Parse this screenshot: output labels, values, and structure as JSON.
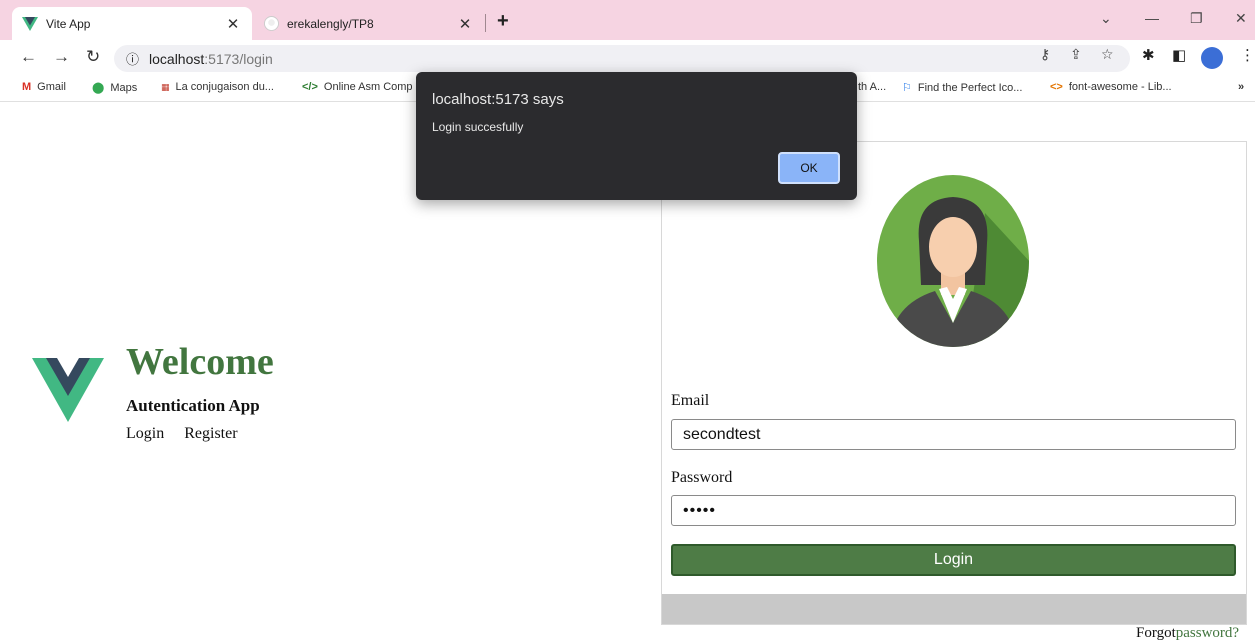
{
  "browser": {
    "tabs": [
      {
        "title": "Vite App",
        "active": true
      },
      {
        "title": "erekalengly/TP8",
        "active": false
      }
    ],
    "url_host": "localhost",
    "url_path": ":5173/login",
    "bookmarks": [
      {
        "label": "Gmail"
      },
      {
        "label": "Maps"
      },
      {
        "label": "La conjugaison du..."
      },
      {
        "label": "Online Asm Comp"
      },
      {
        "label": "th A..."
      },
      {
        "label": "Find the Perfect Ico..."
      },
      {
        "label": "font-awesome - Lib..."
      }
    ],
    "more_bookmarks": "»"
  },
  "dialog": {
    "title": "localhost:5173 says",
    "message": "Login succesfully",
    "ok_label": "OK"
  },
  "hero": {
    "welcome": "Welcome",
    "app_name": "Autentication App",
    "links": [
      "Login",
      "Register"
    ]
  },
  "form": {
    "email_label": "Email",
    "email_value": "secondtest",
    "password_label": "Password",
    "password_value": "•••••",
    "login_label": "Login",
    "forgot_prefix": "Forgot",
    "forgot_link": "password?"
  },
  "colors": {
    "accent_green": "#42763f",
    "button_green": "#4e7c46",
    "tab_strip": "#f6d4e2",
    "dialog_bg": "#2b2b2e",
    "ok_button": "#8ab4f8"
  }
}
